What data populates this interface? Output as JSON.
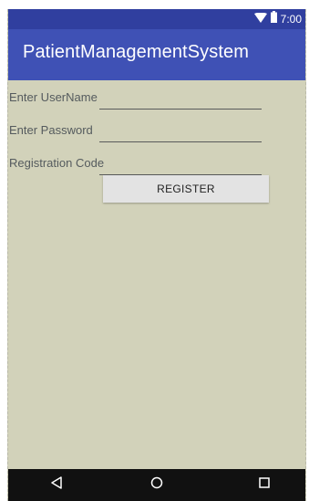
{
  "status_bar": {
    "time": "7:00",
    "icons": [
      "wifi-icon",
      "battery-icon"
    ]
  },
  "app_bar": {
    "title": "PatientManagementSystem"
  },
  "form": {
    "username_label": "Enter UserName",
    "username_value": "",
    "password_label": "Enter Password",
    "password_value": "",
    "code_label": "Registration Code",
    "code_value": "",
    "register_label": "REGISTER"
  },
  "nav_bar": {
    "icons": [
      "back-icon",
      "home-icon",
      "recents-icon"
    ]
  },
  "colors": {
    "status_bar": "#303f9f",
    "app_bar": "#3f51b5",
    "background": "#d2d2ba",
    "nav_bar": "#111111",
    "button": "#e3e3e3"
  }
}
